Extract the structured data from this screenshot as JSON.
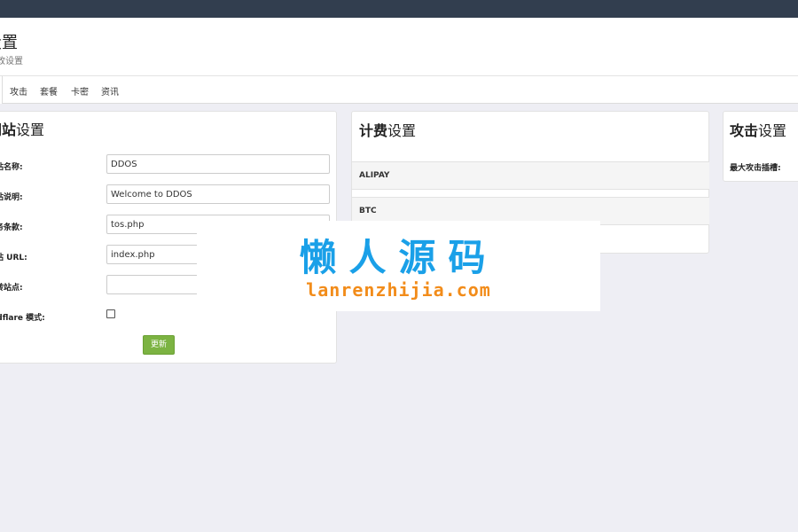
{
  "header": {
    "title": "设置",
    "subtitle": "更改设置"
  },
  "tabs": [
    {
      "label": "攻击"
    },
    {
      "label": "套餐"
    },
    {
      "label": "卡密"
    },
    {
      "label": "资讯"
    }
  ],
  "site_panel": {
    "title_bold": "网站",
    "title_rest": "设置",
    "fields": [
      {
        "label": "网站名称:",
        "value": "DDOS"
      },
      {
        "label": "网站说明:",
        "value": "Welcome to DDOS"
      },
      {
        "label": "服务条款:",
        "value": "tos.php"
      },
      {
        "label": "网站 URL:",
        "value": "index.php"
      },
      {
        "label": "跳转站点:",
        "value": ""
      }
    ],
    "cloudflare_label": "Cloudflare 模式:",
    "cloudflare_checked": false,
    "update_label": "更新"
  },
  "billing_panel": {
    "title_bold": "计费",
    "title_rest": "设置",
    "rows": [
      {
        "label": "ALIPAY"
      },
      {
        "label": "BTC"
      }
    ]
  },
  "attack_panel": {
    "title_bold": "攻击",
    "title_rest": "设置",
    "max_slots_label": "最大攻击插槽:"
  },
  "watermark": {
    "title": "懒人源码",
    "subtitle": "lanrenzhijia.com"
  },
  "colors": {
    "topbar": "#323e4f",
    "update_button": "#7cb342",
    "watermark_title": "#1aa0e8",
    "watermark_subtitle": "#f28c1a"
  }
}
